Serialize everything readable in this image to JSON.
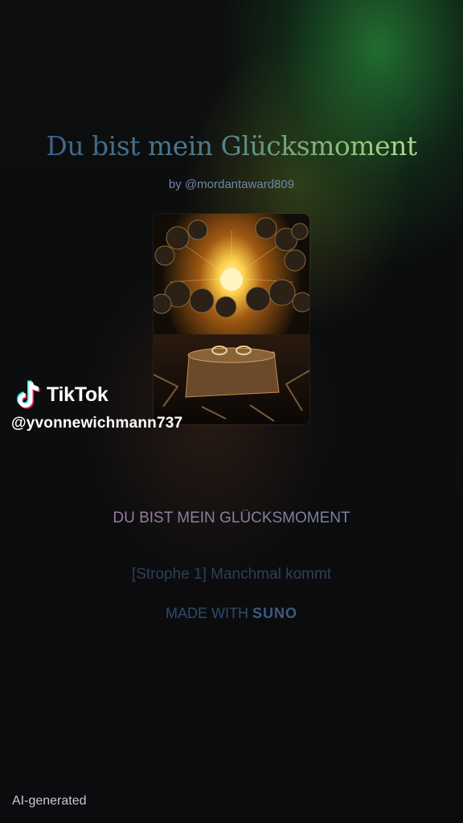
{
  "song": {
    "title": "Du bist mein Glücksmoment",
    "byline": "by @mordantaward809"
  },
  "cover": {
    "icon": "cover-art-image"
  },
  "overlay": {
    "brand_name": "TikTok",
    "username": "@yvonnewichmann737"
  },
  "lyrics": {
    "heading": "DU BIST MEIN GLÜCKSMOMENT",
    "current_line": "[Strophe 1] Manchmal kommt"
  },
  "credit": {
    "prefix": "MADE WITH",
    "brand": "SUNO"
  },
  "footer": {
    "ai_label": "AI-generated"
  },
  "colors": {
    "background": "#0b0c0d",
    "glow_green": "#2e8c3c",
    "title_start": "#3a5a86",
    "title_end": "#c8e6a0"
  }
}
